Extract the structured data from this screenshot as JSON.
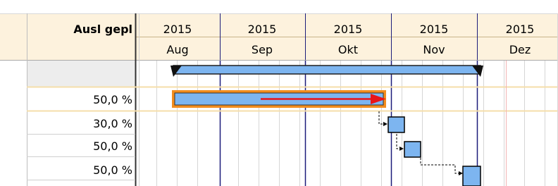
{
  "header": {
    "column_title": "Ausl gepl",
    "timescale": [
      {
        "year": "2015",
        "month": "Aug"
      },
      {
        "year": "2015",
        "month": "Sep"
      },
      {
        "year": "2015",
        "month": "Okt"
      },
      {
        "year": "2015",
        "month": "Nov"
      },
      {
        "year": "2015",
        "month": "Dez"
      }
    ]
  },
  "rows": [
    {
      "value": "",
      "type": "summary"
    },
    {
      "value": "50,0 %",
      "type": "task-selected"
    },
    {
      "value": "30,0 %",
      "type": "milestone-task"
    },
    {
      "value": "50,0 %",
      "type": "milestone-task"
    },
    {
      "value": "50,0 %",
      "type": "milestone-task"
    }
  ],
  "colors": {
    "header_bg": "#fdf2dd",
    "bar_fill": "#7db5f0",
    "bar_border": "#1f1f1f",
    "selection_border": "#f28c1e",
    "progress_arrow": "#e8141a",
    "month_line": "#1c1c7a",
    "today_line": "#f2b2b2",
    "row_highlight": "#f5deaa"
  }
}
